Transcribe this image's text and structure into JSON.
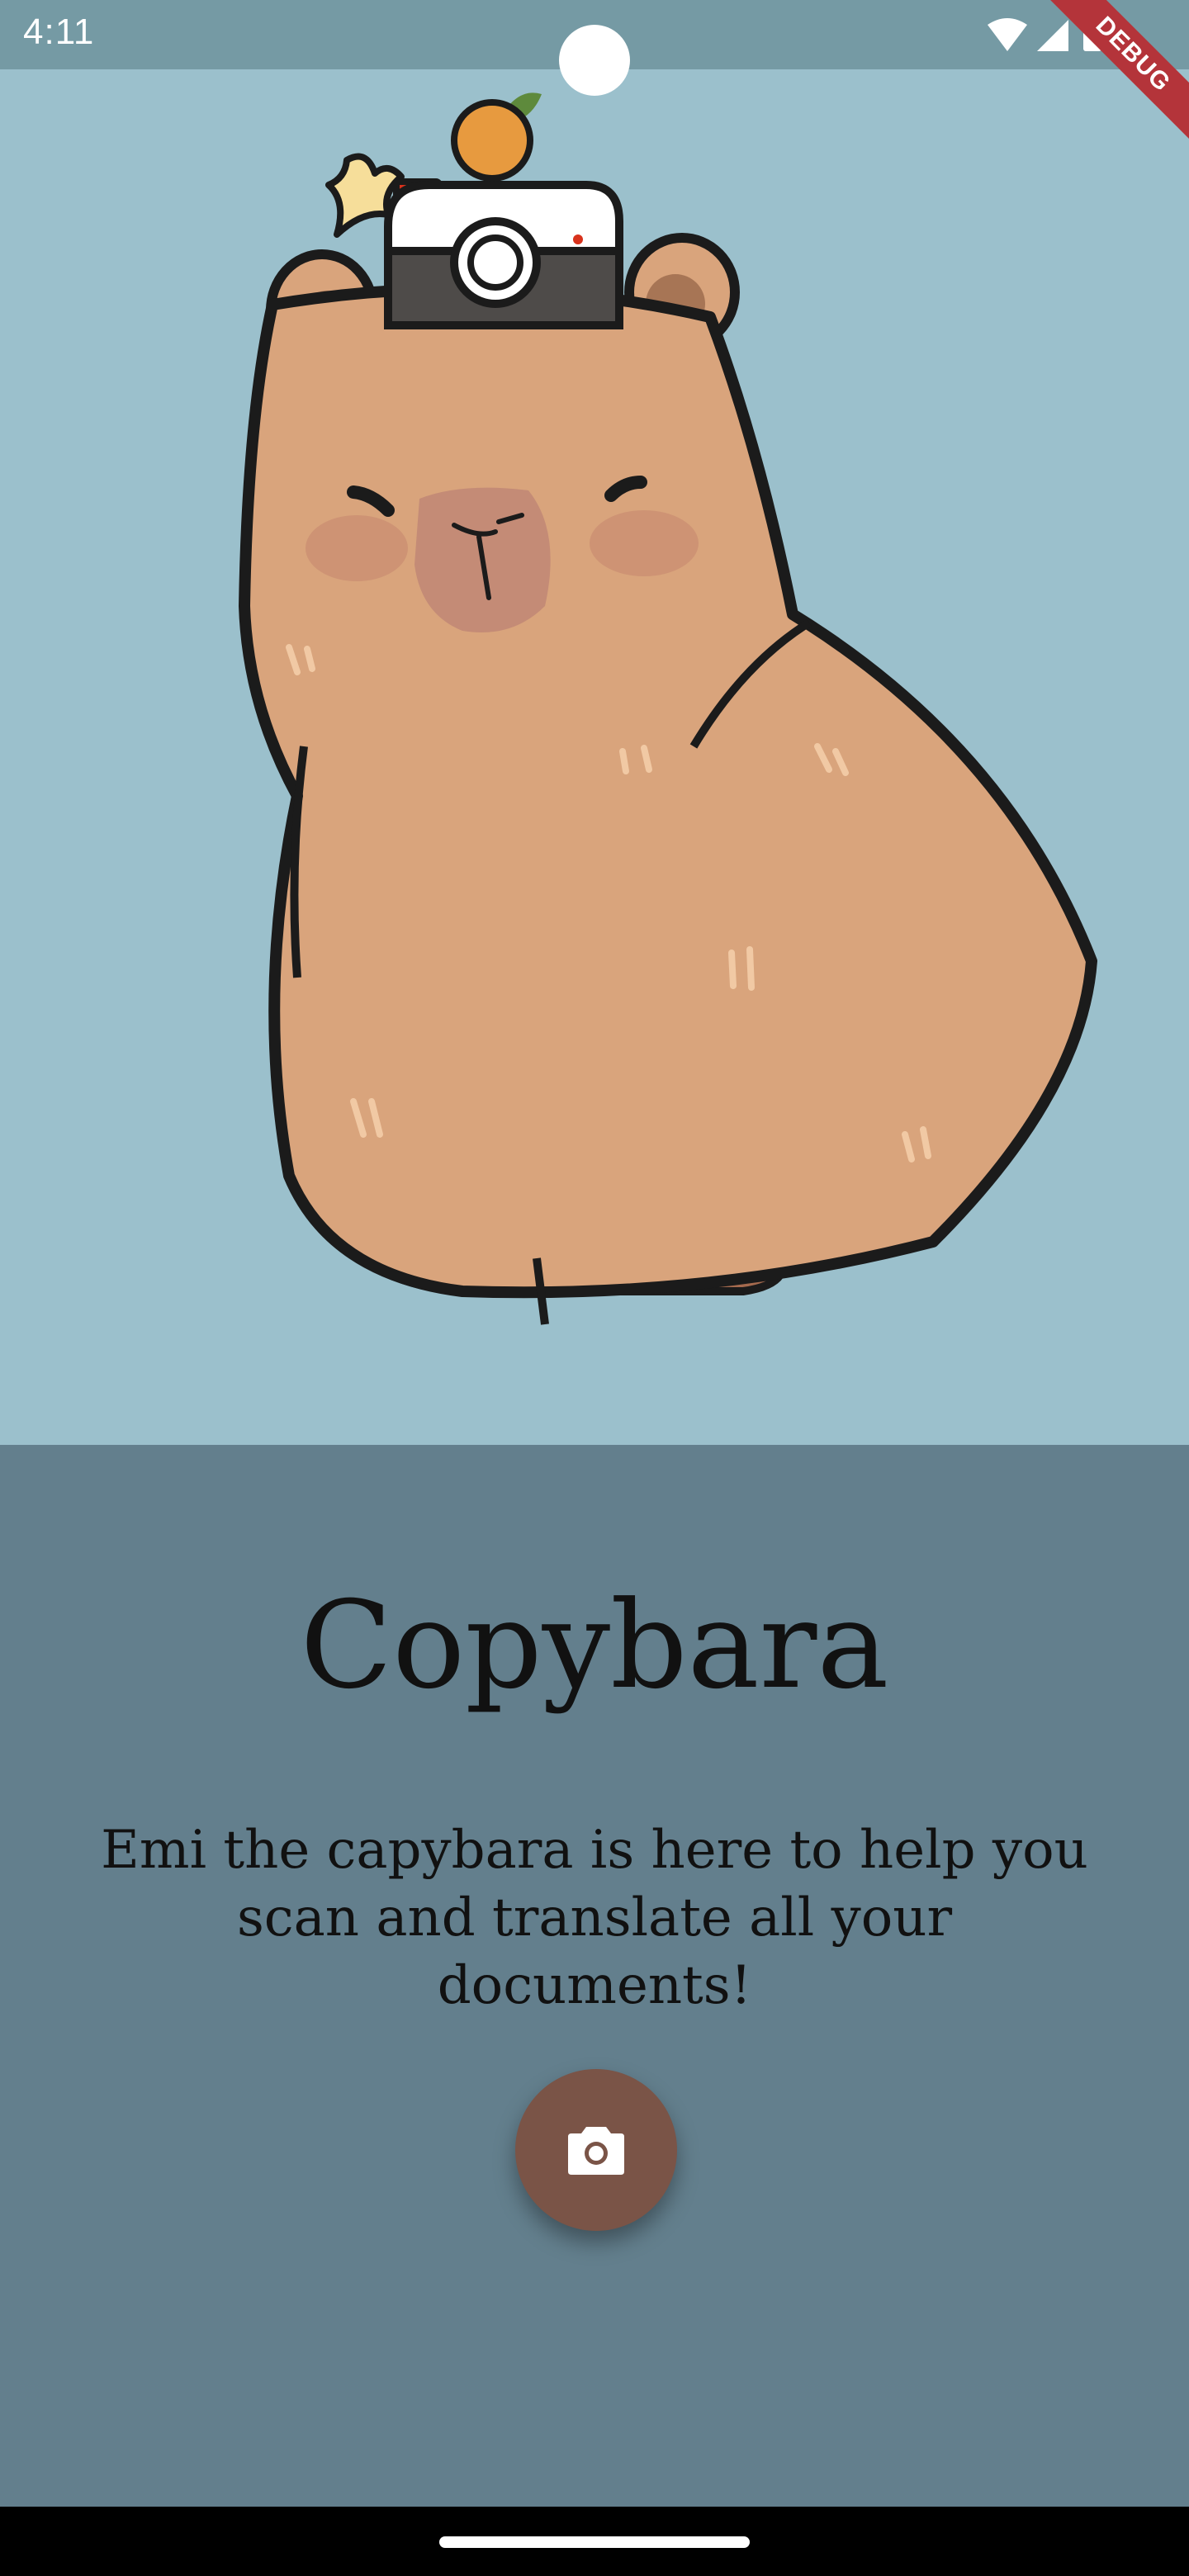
{
  "status_bar": {
    "time": "4:11"
  },
  "debug_banner": {
    "label": "DEBUG"
  },
  "hero": {
    "illustration": "capybara-with-camera-and-orange"
  },
  "content": {
    "title": "Copybara",
    "subtitle": "Emi the capybara is here to help you scan and translate all your documents!",
    "fab_icon": "camera-icon"
  },
  "colors": {
    "status_bar": "#759aa4",
    "hero_background": "#9bc0cc",
    "content_background": "#637f8d",
    "fab": "#7a5447",
    "debug_ribbon": "#b4343a",
    "capybara_fur": "#d9a47c"
  }
}
